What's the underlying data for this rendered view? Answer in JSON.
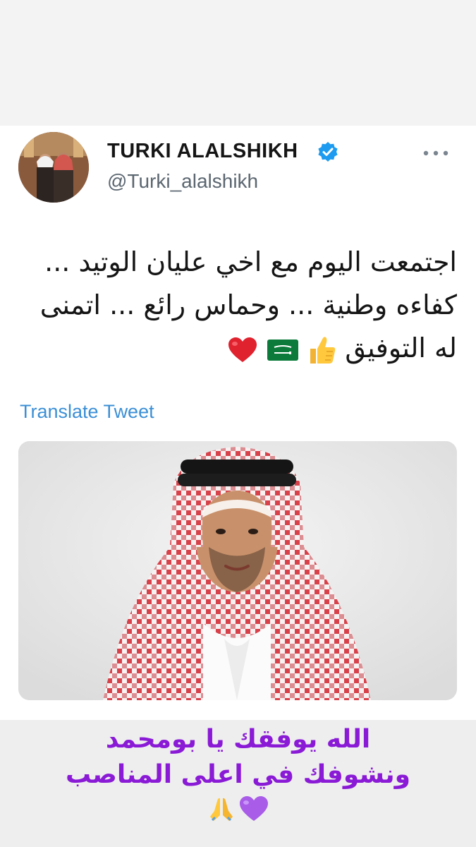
{
  "tweet": {
    "author_name": "TURKI ALALSHIKH",
    "handle": "@Turki_alalshikh",
    "lines": [
      "اجتمعت اليوم مع اخي عليان الوتيد ...",
      "كفاءه وطنية ... وحماس رائع ... اتمنى",
      "له التوفيق"
    ],
    "line3_emojis": [
      "thumbs-up",
      "saudi-flag",
      "red-heart"
    ],
    "translate_label": "Translate Tweet"
  },
  "story_caption": {
    "lines": [
      "الله يوفقك يا بومحمد",
      "ونشوفك في اعلى المناصب"
    ],
    "emojis": [
      "purple-heart",
      "folded-hands"
    ]
  },
  "colors": {
    "verified": "#1d9bf0",
    "link": "#3b8fd6",
    "caption": "#8a1ad6"
  }
}
